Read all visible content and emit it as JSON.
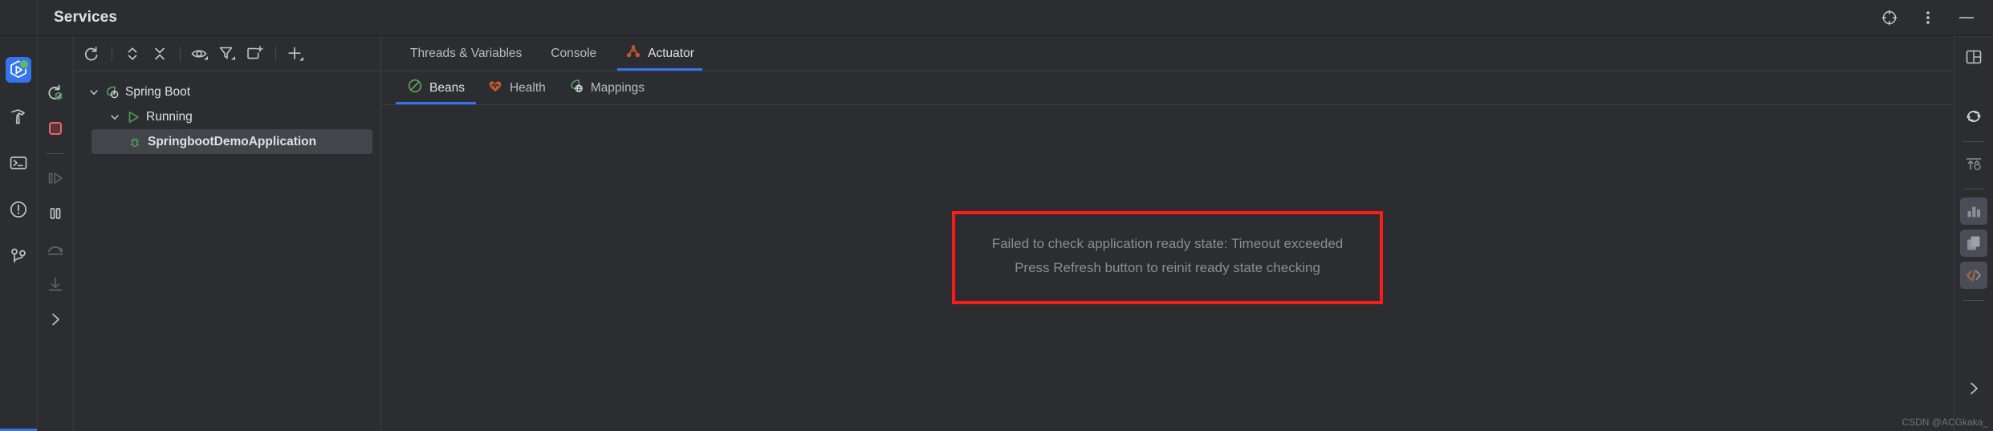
{
  "header": {
    "title": "Services",
    "icons": [
      {
        "name": "target-icon",
        "glyph": "target"
      },
      {
        "name": "more-vertical-icon",
        "glyph": "dots"
      },
      {
        "name": "minimize-icon",
        "glyph": "minus"
      }
    ]
  },
  "left_rail": {
    "items": [
      {
        "name": "sidebar-item-services",
        "label": "Services",
        "icon": "services-run-icon",
        "active": true
      },
      {
        "name": "sidebar-item-build",
        "label": "Build",
        "icon": "hammer-icon",
        "active": false
      },
      {
        "name": "sidebar-item-terminal",
        "label": "Terminal",
        "icon": "terminal-icon",
        "active": false
      },
      {
        "name": "sidebar-item-problems",
        "label": "Problems",
        "icon": "warning-circle-icon",
        "active": false
      },
      {
        "name": "sidebar-item-git",
        "label": "Git",
        "icon": "git-branch-icon",
        "active": false
      }
    ]
  },
  "run_controls": {
    "items": [
      {
        "name": "rerun-debug-button",
        "label": "Rerun",
        "icon": "rerun-debug-icon",
        "enabled": true
      },
      {
        "name": "stop-button",
        "label": "Stop",
        "icon": "stop-square-icon",
        "enabled": true
      },
      {
        "name": "resume-button",
        "label": "Resume Program",
        "icon": "resume-icon",
        "enabled": false
      },
      {
        "name": "pause-button",
        "label": "Pause Program",
        "icon": "pause-icon",
        "enabled": true
      },
      {
        "name": "step-over-button",
        "label": "Step Over",
        "icon": "step-over-icon",
        "enabled": false
      },
      {
        "name": "step-into-button",
        "label": "Step Into",
        "icon": "step-into-icon",
        "enabled": false
      },
      {
        "name": "expand-run-toolbar-button",
        "label": "More",
        "icon": "chevron-right-icon",
        "enabled": true
      }
    ]
  },
  "tree_toolbar": {
    "items": [
      {
        "name": "refresh-button",
        "label": "Refresh",
        "icon": "refresh-icon"
      },
      {
        "name": "expand-all-button",
        "label": "Expand All",
        "icon": "expand-chevrons-icon"
      },
      {
        "name": "collapse-all-button",
        "label": "Collapse All",
        "icon": "collapse-x-icon"
      },
      {
        "name": "show-options-button",
        "label": "Show",
        "icon": "eye-icon"
      },
      {
        "name": "filter-button",
        "label": "Filter",
        "icon": "filter-funnel-icon"
      },
      {
        "name": "group-button",
        "label": "Group",
        "icon": "new-group-icon"
      },
      {
        "name": "add-service-button",
        "label": "Add Service",
        "icon": "plus-icon"
      }
    ]
  },
  "tree": {
    "nodes": [
      {
        "name": "tree-node-spring-boot",
        "label": "Spring Boot",
        "icon": "spring-leaf-icon",
        "level": 0,
        "expanded": true,
        "selected": false
      },
      {
        "name": "tree-node-running",
        "label": "Running",
        "icon": "run-triangle-icon",
        "level": 1,
        "expanded": true,
        "selected": false
      },
      {
        "name": "tree-node-springboot-demo-application",
        "label": "SpringbootDemoApplication",
        "icon": "debug-bug-icon",
        "level": 2,
        "expanded": false,
        "selected": true
      }
    ]
  },
  "main": {
    "tabs": [
      {
        "name": "tab-threads-and-variables",
        "label": "Threads & Variables",
        "icon": null,
        "active": false
      },
      {
        "name": "tab-console",
        "label": "Console",
        "icon": null,
        "active": false
      },
      {
        "name": "tab-actuator",
        "label": "Actuator",
        "icon": "actuator-network-icon",
        "active": true
      }
    ],
    "subtabs": [
      {
        "name": "subtab-beans",
        "label": "Beans",
        "icon": "beans-circle-slash-icon",
        "active": true
      },
      {
        "name": "subtab-health",
        "label": "Health",
        "icon": "health-heart-icon",
        "active": false
      },
      {
        "name": "subtab-mappings",
        "label": "Mappings",
        "icon": "mappings-globe-icon",
        "active": false
      }
    ],
    "error": {
      "name": "actuator-error-message",
      "line1": "Failed to check application ready state: Timeout exceeded",
      "line2": "Press Refresh button to reinit ready state checking",
      "border_color": "#ff1a1a",
      "text_color": "#8a8d92"
    }
  },
  "right_rail": {
    "split_button": {
      "name": "split-view-button",
      "label": "Split View",
      "icon": "split-panel-icon"
    },
    "items": [
      {
        "name": "refresh-actuator-button",
        "label": "Refresh",
        "icon": "circular-refresh-icon",
        "tinted": false
      },
      {
        "name": "export-data-button",
        "label": "Export",
        "icon": "export-arrows-icon",
        "tinted": false
      },
      {
        "name": "charts-button",
        "label": "Charts",
        "icon": "bar-chart-icon",
        "tinted": true
      },
      {
        "name": "copy-button",
        "label": "Copy",
        "icon": "copy-pages-icon",
        "tinted": true
      },
      {
        "name": "code-button",
        "label": "Code",
        "icon": "code-brackets-icon",
        "tinted": true
      }
    ],
    "expand_button": {
      "name": "expand-right-toolbar-button",
      "label": "More",
      "icon": "chevron-right-icon"
    }
  },
  "watermark": {
    "name": "watermark-text",
    "text": "CSDN @ACGkaka_"
  },
  "colors": {
    "accent_blue": "#3574f0",
    "spring_green": "#5fa65f",
    "actuator_orange": "#c05a2a",
    "error_red": "#ff1a1a",
    "bg": "#2b2d30",
    "selection": "#43454a"
  }
}
